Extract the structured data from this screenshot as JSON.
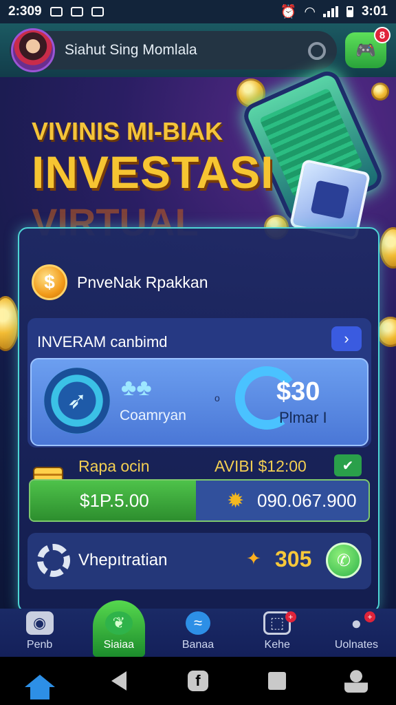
{
  "status_bar": {
    "time_left": "2:309",
    "time_right": "3:01"
  },
  "header": {
    "username": "Siahut Sing Momlala",
    "badge_count": "8"
  },
  "hero": {
    "subtitle": "VIVINIS MI-BIAK",
    "title": "INVESTASI",
    "title_ghost": "VIRTUAL"
  },
  "panel": {
    "title": "PnveNak Rpakkan",
    "coin_symbol": "$",
    "card1": {
      "title": "INVERAM canbimd",
      "left_label": "Coamryan",
      "dot": "o",
      "amount": "$30",
      "amount_label": "Plmar I"
    },
    "card2": {
      "label": "Rapa ocin",
      "right_label": "AVIBI $12:00",
      "left_value": "$1P.5.00",
      "right_value": "090.067.900",
      "progress": 0.49
    },
    "card3": {
      "label": "Vhepıtratian",
      "value": "305"
    }
  },
  "tabbar": {
    "tabs": [
      {
        "label": "Penb",
        "icon": "gamepad-icon"
      },
      {
        "label": "Siaiaa",
        "icon": "leaf-icon"
      },
      {
        "label": "Banaa",
        "icon": "globe-icon"
      },
      {
        "label": "Kehe",
        "icon": "screen-icon"
      },
      {
        "label": "Uolnates",
        "icon": "user-icon"
      }
    ]
  },
  "colors": {
    "accent_gold": "#f6c532",
    "accent_green": "#2aa33a",
    "panel_border": "#4ed6d6"
  }
}
